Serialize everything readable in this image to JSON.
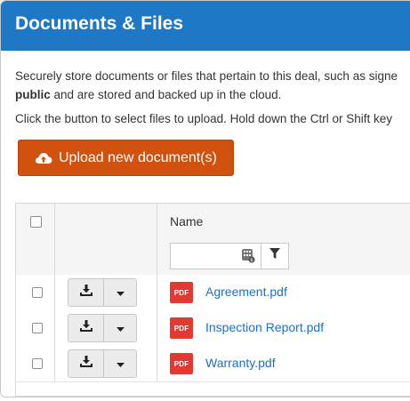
{
  "panel": {
    "title": "Documents & Files",
    "header_color": "#1e78c6"
  },
  "description": {
    "line1": "Securely store documents or files that pertain to this deal, such as signe",
    "line2_bold": "public",
    "line2_rest": " and are stored and backed up in the cloud.",
    "line3": "Click the button to select files to upload. Hold down the Ctrl or Shift key"
  },
  "upload_button": {
    "label": "Upload new document(s)",
    "icon": "cloud-upload-icon",
    "color": "#d1510f"
  },
  "grid": {
    "columns": [
      "",
      "",
      "Name"
    ],
    "filter": {
      "value": "",
      "placeholder": "",
      "icons": [
        "calculator-icon",
        "filter-icon"
      ]
    },
    "rows": [
      {
        "file_name": "Agreement.pdf",
        "file_type": "PDF",
        "checked": false
      },
      {
        "file_name": "Inspection Report.pdf",
        "file_type": "PDF",
        "checked": false
      },
      {
        "file_name": "Warranty.pdf",
        "file_type": "PDF",
        "checked": false
      }
    ],
    "row_actions": {
      "primary_icon": "download-icon",
      "secondary_icon": "caret-down-icon"
    },
    "link_color": "#1f6fc2",
    "pdf_icon_color": "#e03a32"
  }
}
